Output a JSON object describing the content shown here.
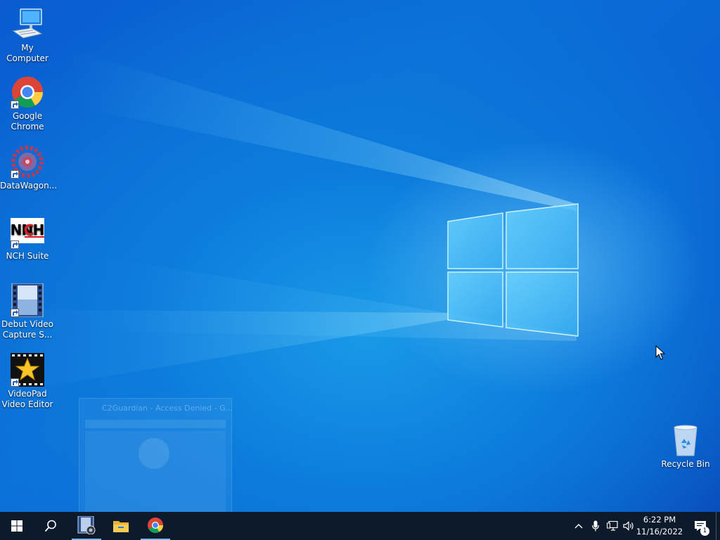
{
  "desktop": {
    "icons": [
      {
        "label": "My Computer"
      },
      {
        "label": "Google Chrome"
      },
      {
        "label": "DataWagon..."
      },
      {
        "label": "NCH Suite"
      },
      {
        "label": "Debut Video Capture S..."
      },
      {
        "label": "VideoPad Video Editor"
      },
      {
        "label": "Recycle Bin"
      }
    ],
    "ghost_window": {
      "title": "C2Guardian - Access Denied - G..."
    }
  },
  "taskbar": {
    "start": {
      "icon": "windows-logo-icon"
    },
    "search": {
      "icon": "search-icon"
    },
    "apps": [
      {
        "name": "Debut Video Capture",
        "icon": "debut-icon",
        "active": true
      },
      {
        "name": "File Explorer",
        "icon": "folder-icon",
        "active": false
      },
      {
        "name": "Google Chrome",
        "icon": "chrome-icon",
        "active": true
      }
    ],
    "tray": {
      "icons": [
        "chevron-up-icon",
        "microphone-icon",
        "network-icon",
        "volume-icon"
      ],
      "time": "6:22 PM",
      "date": "11/16/2022",
      "notification_count": "1"
    }
  },
  "colors": {
    "taskbar_bg": "#0c1a2b",
    "active_indicator": "#76b9ed",
    "desktop_blue": "#0b6fd8"
  }
}
